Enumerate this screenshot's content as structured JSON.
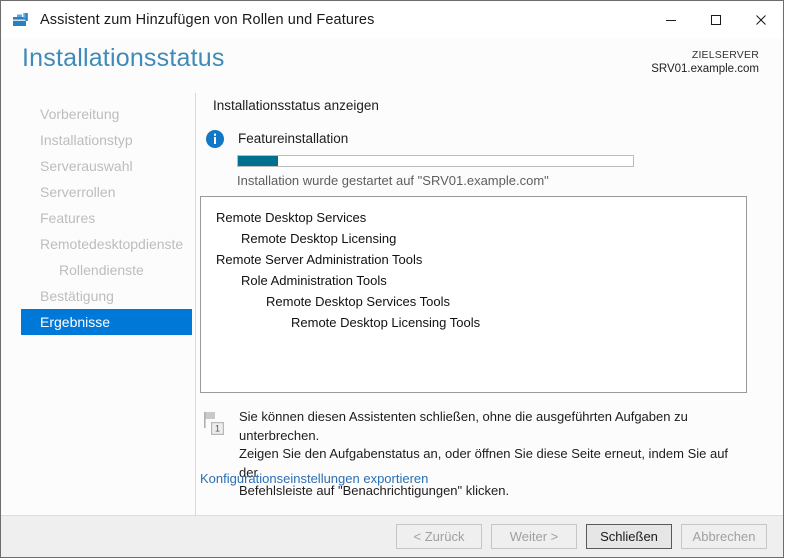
{
  "window": {
    "title": "Assistent zum Hinzufügen von Rollen und Features",
    "icon": "server-toolbox-icon",
    "controls": {
      "minimize": "minimize-icon",
      "maximize": "maximize-icon",
      "close": "close-icon"
    }
  },
  "header": {
    "page_title": "Installationsstatus",
    "target_label": "ZIELSERVER",
    "target_name": "SRV01.example.com"
  },
  "sidebar": {
    "items": [
      {
        "label": "Vorbereitung",
        "selected": false,
        "indented": false
      },
      {
        "label": "Installationstyp",
        "selected": false,
        "indented": false
      },
      {
        "label": "Serverauswahl",
        "selected": false,
        "indented": false
      },
      {
        "label": "Serverrollen",
        "selected": false,
        "indented": false
      },
      {
        "label": "Features",
        "selected": false,
        "indented": false
      },
      {
        "label": "Remotedesktopdienste",
        "selected": false,
        "indented": false
      },
      {
        "label": "Rollendienste",
        "selected": false,
        "indented": true
      },
      {
        "label": "Bestätigung",
        "selected": false,
        "indented": false
      },
      {
        "label": "Ergebnisse",
        "selected": true,
        "indented": false
      }
    ],
    "selected_color": "#0078d7",
    "disabled_color": "#bdbdbd"
  },
  "content": {
    "heading": "Installationsstatus anzeigen",
    "info_icon": "info-circle-icon",
    "info_label": "Featureinstallation",
    "progress": {
      "percent": 10,
      "fill_color": "#00708f",
      "status_text": "Installation wurde gestartet auf \"SRV01.example.com\""
    },
    "results": [
      {
        "label": "Remote Desktop Services",
        "level": 0
      },
      {
        "label": "Remote Desktop Licensing",
        "level": 1
      },
      {
        "label": "Remote Server Administration Tools",
        "level": 0
      },
      {
        "label": "Role Administration Tools",
        "level": 1
      },
      {
        "label": "Remote Desktop Services Tools",
        "level": 2
      },
      {
        "label": "Remote Desktop Licensing Tools",
        "level": 3
      }
    ],
    "note": {
      "icon": "notification-flag-icon",
      "badge": "1",
      "line1": "Sie können diesen Assistenten schließen, ohne die ausgeführten Aufgaben zu unterbrechen.",
      "line2": "Zeigen Sie den Aufgabenstatus an, oder öffnen Sie diese Seite erneut, indem Sie auf der",
      "line3": "Befehlsleiste auf \"Benachrichtigungen\" klicken."
    },
    "export_link": "Konfigurationseinstellungen exportieren"
  },
  "footer": {
    "back_label": "< Zurück",
    "next_label": "Weiter >",
    "close_label": "Schließen",
    "cancel_label": "Abbrechen"
  }
}
